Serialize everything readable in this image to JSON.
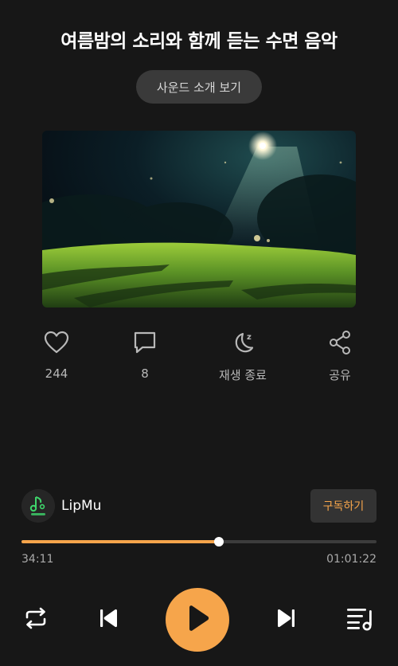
{
  "track": {
    "title": "여름밤의 소리와 함께 듣는 수면 음악",
    "intro_button": "사운드 소개 보기"
  },
  "actions": {
    "like_count": "244",
    "comment_count": "8",
    "sleep_timer_label": "재생 종료",
    "share_label": "공유"
  },
  "artist": {
    "name": "LipMu",
    "subscribe_label": "구독하기"
  },
  "player": {
    "current_time": "34:11",
    "total_time": "01:01:22",
    "progress_fraction": 0.557
  },
  "colors": {
    "accent": "#f6a54b",
    "background": "#171717"
  },
  "icons": {
    "like": "heart-icon",
    "comment": "comment-icon",
    "sleep": "moon-icon",
    "share": "share-icon",
    "repeat": "repeat-icon",
    "previous": "previous-icon",
    "play": "play-icon",
    "next": "next-icon",
    "playlist": "playlist-icon"
  }
}
